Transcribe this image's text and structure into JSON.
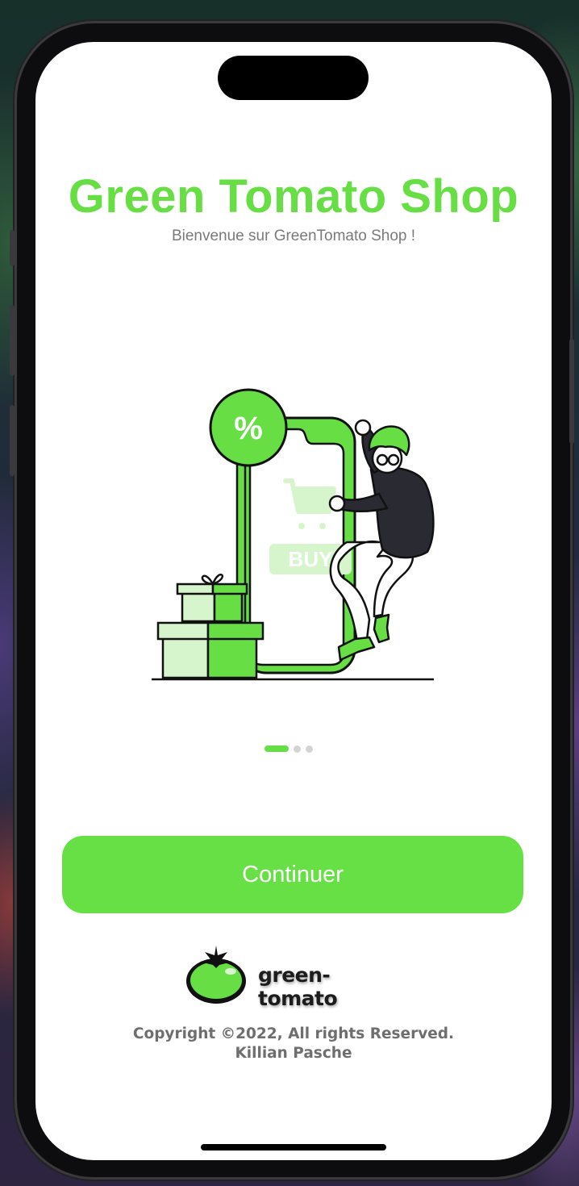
{
  "app": {
    "title": "Green Tomato Shop",
    "subtitle": "Bienvenue sur GreenTomato Shop !"
  },
  "illustration": {
    "badge_text": "%",
    "buy_label": "BUY"
  },
  "pagination": {
    "total_pages": 3,
    "current_page": 1
  },
  "actions": {
    "continue_label": "Continuer"
  },
  "brand": {
    "logo_text": "green-tomato"
  },
  "footer": {
    "copyright_line1": "Copyright ©2022, All rights Reserved.",
    "copyright_line2": "Killian Pasche"
  },
  "colors": {
    "accent": "#66de44",
    "subtitle": "#7a7a7a",
    "footer_text": "#6e6e6e",
    "background": "#ffffff"
  },
  "icons": [
    "cart-icon",
    "tomato-logo-icon",
    "percent-badge-icon",
    "gift-box-icon"
  ]
}
